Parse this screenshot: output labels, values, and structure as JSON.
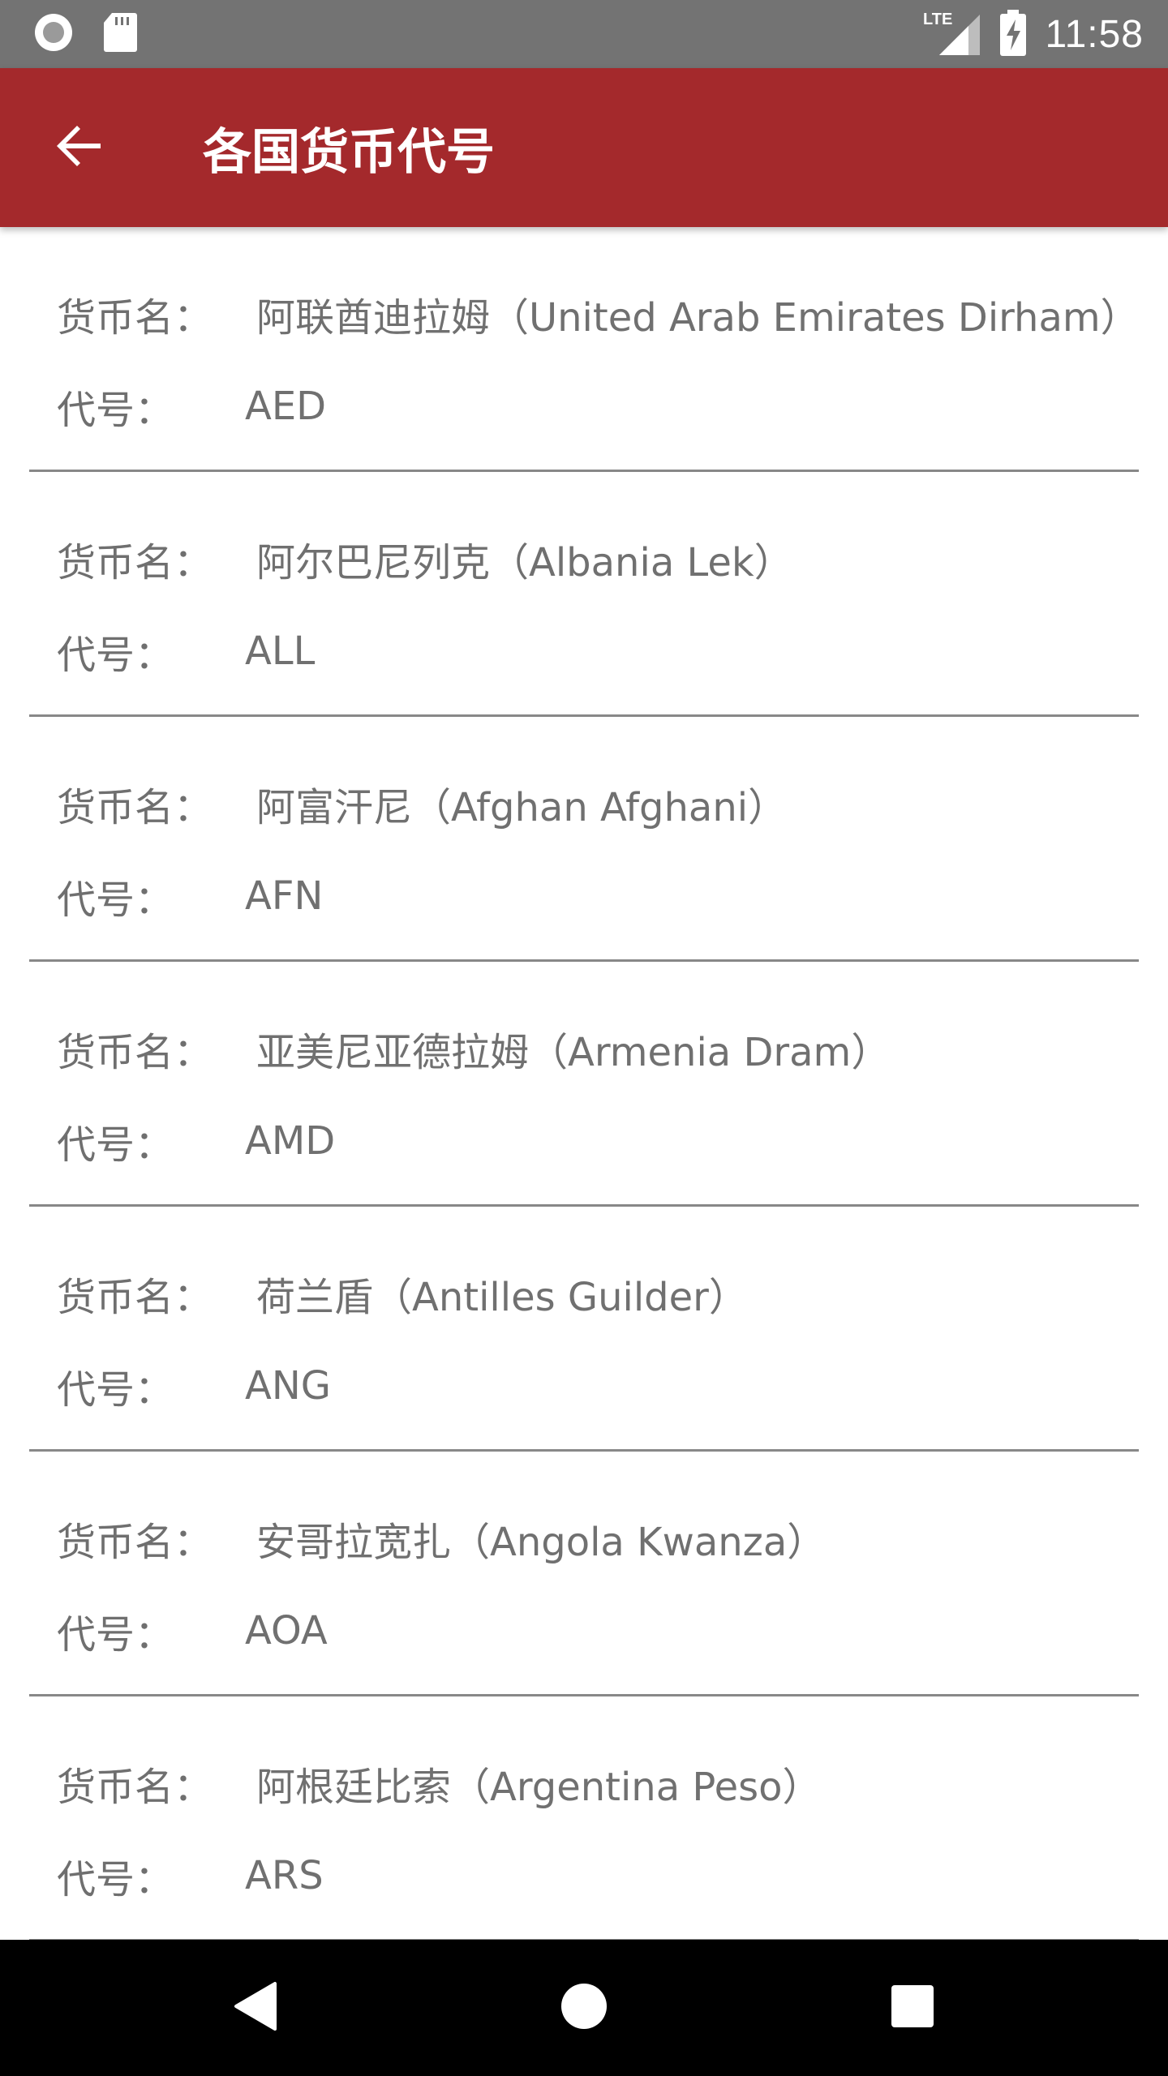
{
  "status_bar": {
    "time": "11:58",
    "network": "LTE",
    "icons": [
      "record-icon",
      "sd-card-icon",
      "lte-signal-icon",
      "battery-charging-icon"
    ]
  },
  "app_bar": {
    "title": "各国货币代号",
    "background_color": "#a4292c",
    "back_icon": "arrow-back-icon"
  },
  "labels": {
    "name": "货币名：",
    "code": "代号："
  },
  "currencies": [
    {
      "name": "阿联酋迪拉姆（United Arab Emirates Dirham）",
      "code": "AED"
    },
    {
      "name": "阿尔巴尼列克（Albania Lek）",
      "code": "ALL"
    },
    {
      "name": "阿富汗尼（Afghan Afghani）",
      "code": "AFN"
    },
    {
      "name": "亚美尼亚德拉姆（Armenia Dram）",
      "code": "AMD"
    },
    {
      "name": "荷兰盾（Antilles Guilder）",
      "code": "ANG"
    },
    {
      "name": "安哥拉宽扎（Angola Kwanza）",
      "code": "AOA"
    },
    {
      "name": "阿根廷比索（Argentina Peso）",
      "code": "ARS"
    }
  ],
  "nav_bar": {
    "icons": [
      "back-triangle-icon",
      "home-circle-icon",
      "recents-square-icon"
    ]
  }
}
